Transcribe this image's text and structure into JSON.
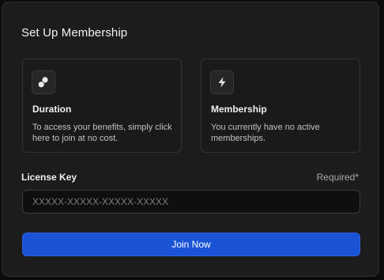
{
  "dialog": {
    "title": "Set Up Membership"
  },
  "cards": [
    {
      "icon": "shapes-icon",
      "title": "Duration",
      "description": "To access your benefits, simply click here to join at no cost."
    },
    {
      "icon": "lightning-bolt-icon",
      "title": "Membership",
      "description": "You currently have no active memberships."
    }
  ],
  "license": {
    "label": "License Key",
    "required_text": "Required*",
    "placeholder": "XXXXX-XXXXX-XXXXX-XXXXX",
    "value": ""
  },
  "join_button": {
    "label": "Join Now"
  },
  "colors": {
    "accent": "#1b53d6",
    "background": "#1c1c1c"
  }
}
